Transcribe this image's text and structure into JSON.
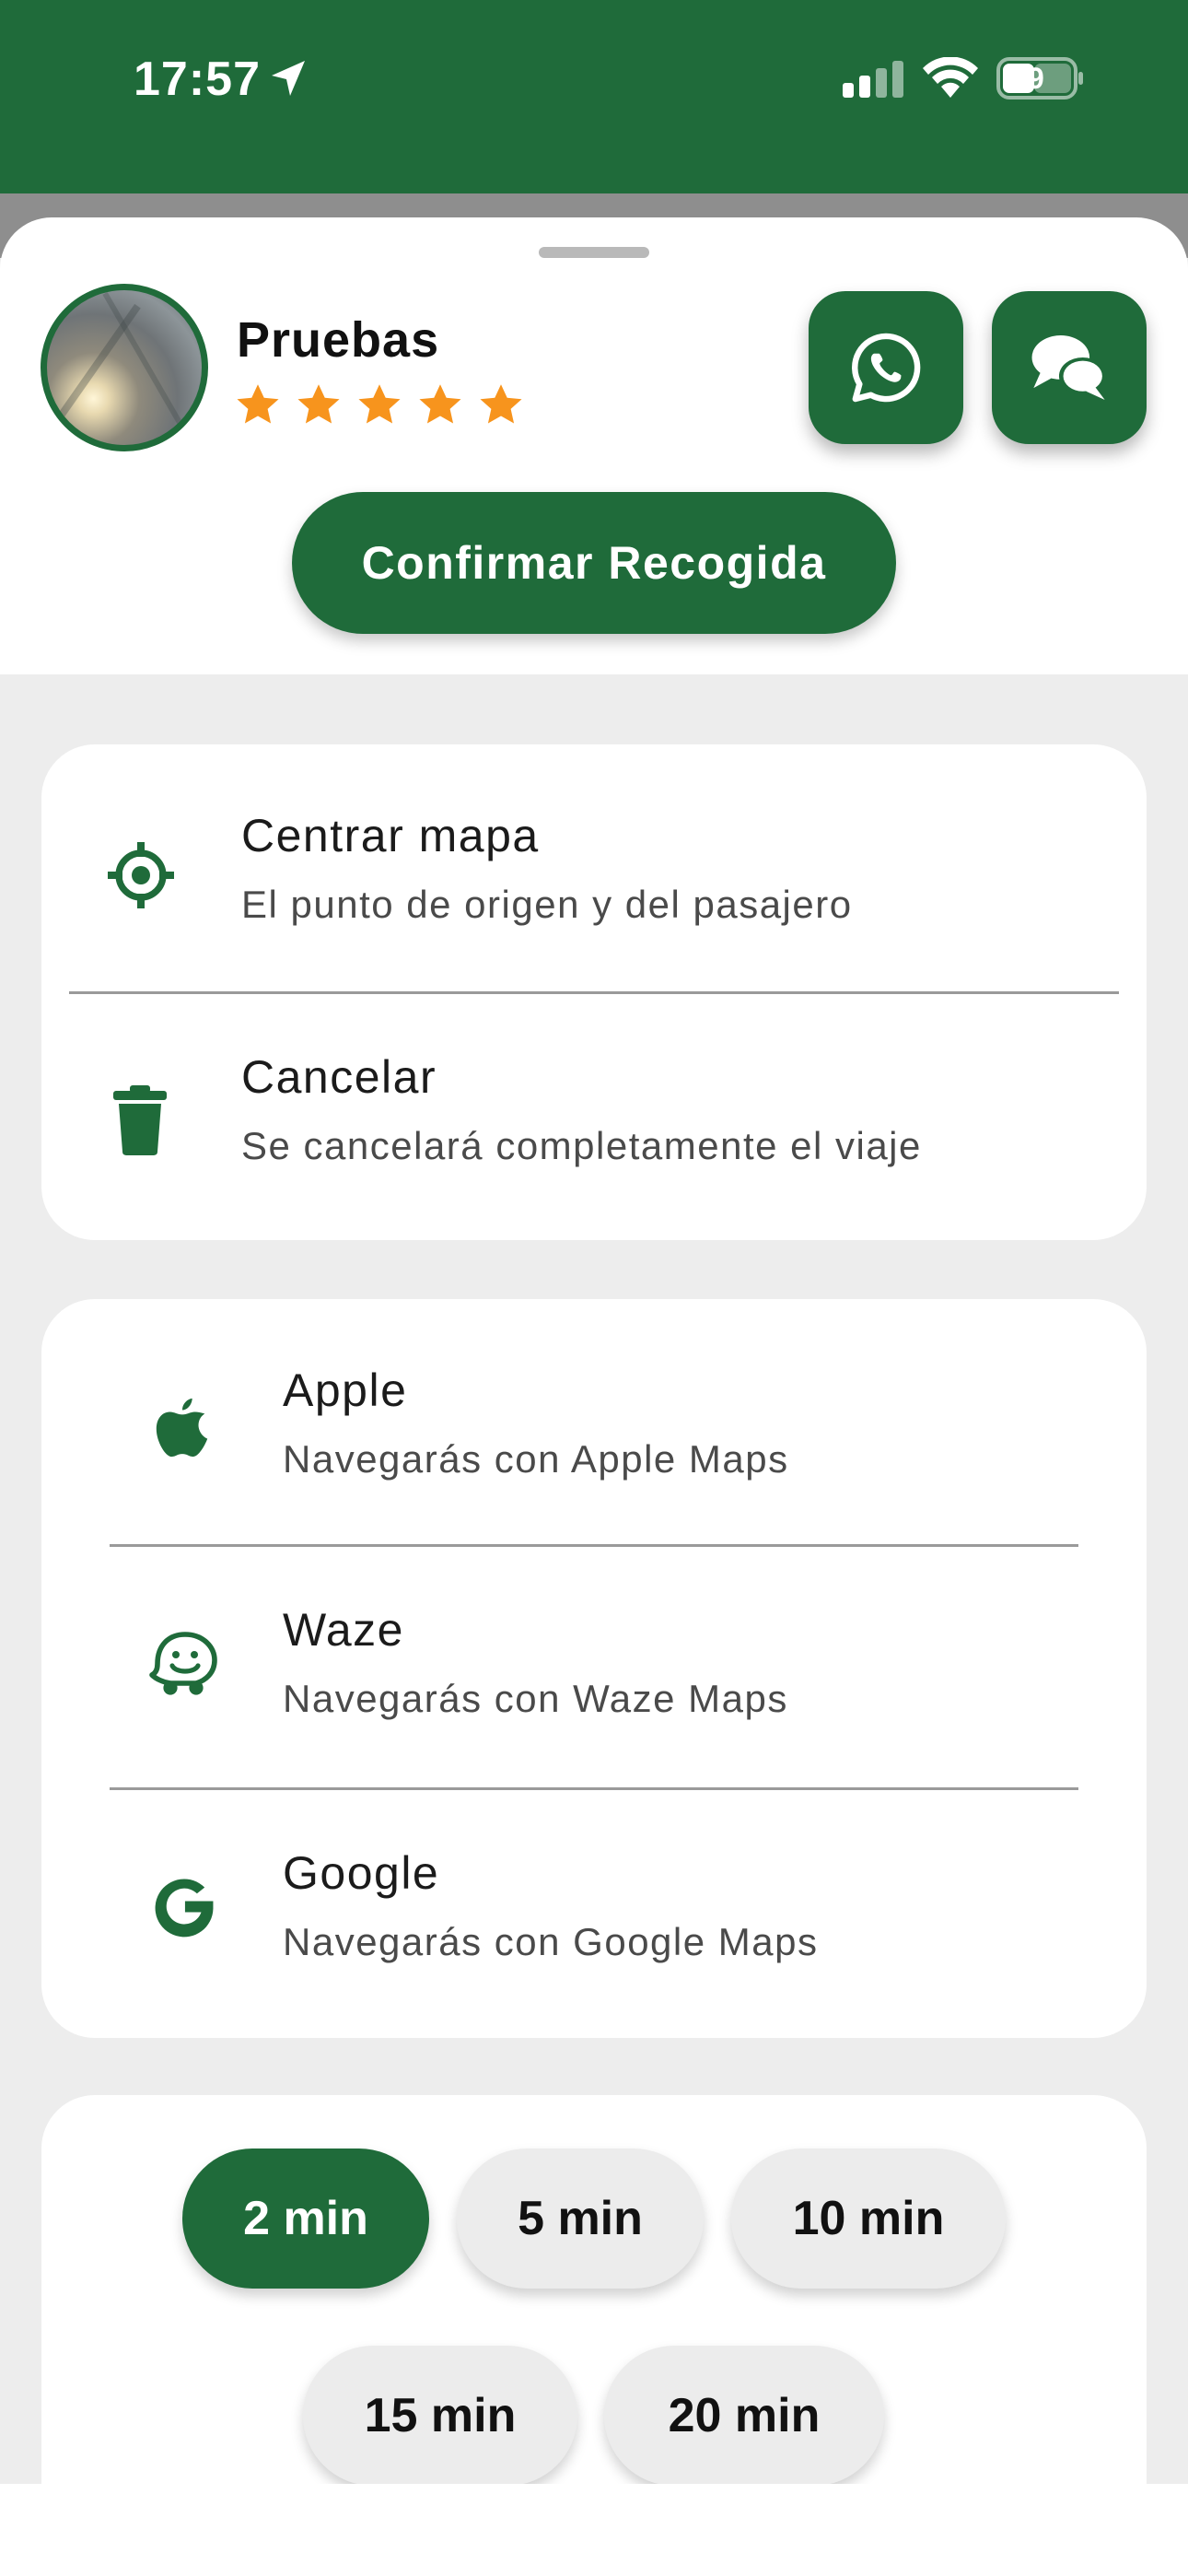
{
  "status_bar": {
    "time": "17:57",
    "battery": "39",
    "bg_color": "#1f6b3a"
  },
  "driver": {
    "name": "Pruebas",
    "rating": 5,
    "rating_max": 5
  },
  "contact_actions": {
    "whatsapp_icon": "whatsapp-icon",
    "chat_icon": "chat-bubbles-icon"
  },
  "confirm_button": {
    "label": "Confirmar Recogida"
  },
  "options": [
    {
      "title": "Centrar mapa",
      "subtitle": "El punto de origen y del pasajero",
      "icon": "crosshair-icon"
    },
    {
      "title": "Cancelar",
      "subtitle": "Se cancelará completamente el viaje",
      "icon": "trash-icon"
    }
  ],
  "navigation": [
    {
      "title": "Apple",
      "subtitle": "Navegarás con Apple Maps",
      "icon": "apple-icon"
    },
    {
      "title": "Waze",
      "subtitle": "Navegarás con Waze Maps",
      "icon": "waze-icon"
    },
    {
      "title": "Google",
      "subtitle": "Navegarás con Google Maps",
      "icon": "google-icon"
    }
  ],
  "time_chips": [
    {
      "label": "2 min",
      "selected": true
    },
    {
      "label": "5 min",
      "selected": false
    },
    {
      "label": "10 min",
      "selected": false
    },
    {
      "label": "15 min",
      "selected": false
    },
    {
      "label": "20 min",
      "selected": false
    }
  ],
  "colors": {
    "primary": "#1f6b3a",
    "star": "#f7941d",
    "background": "#ededed",
    "chip_inactive": "#ececec"
  }
}
